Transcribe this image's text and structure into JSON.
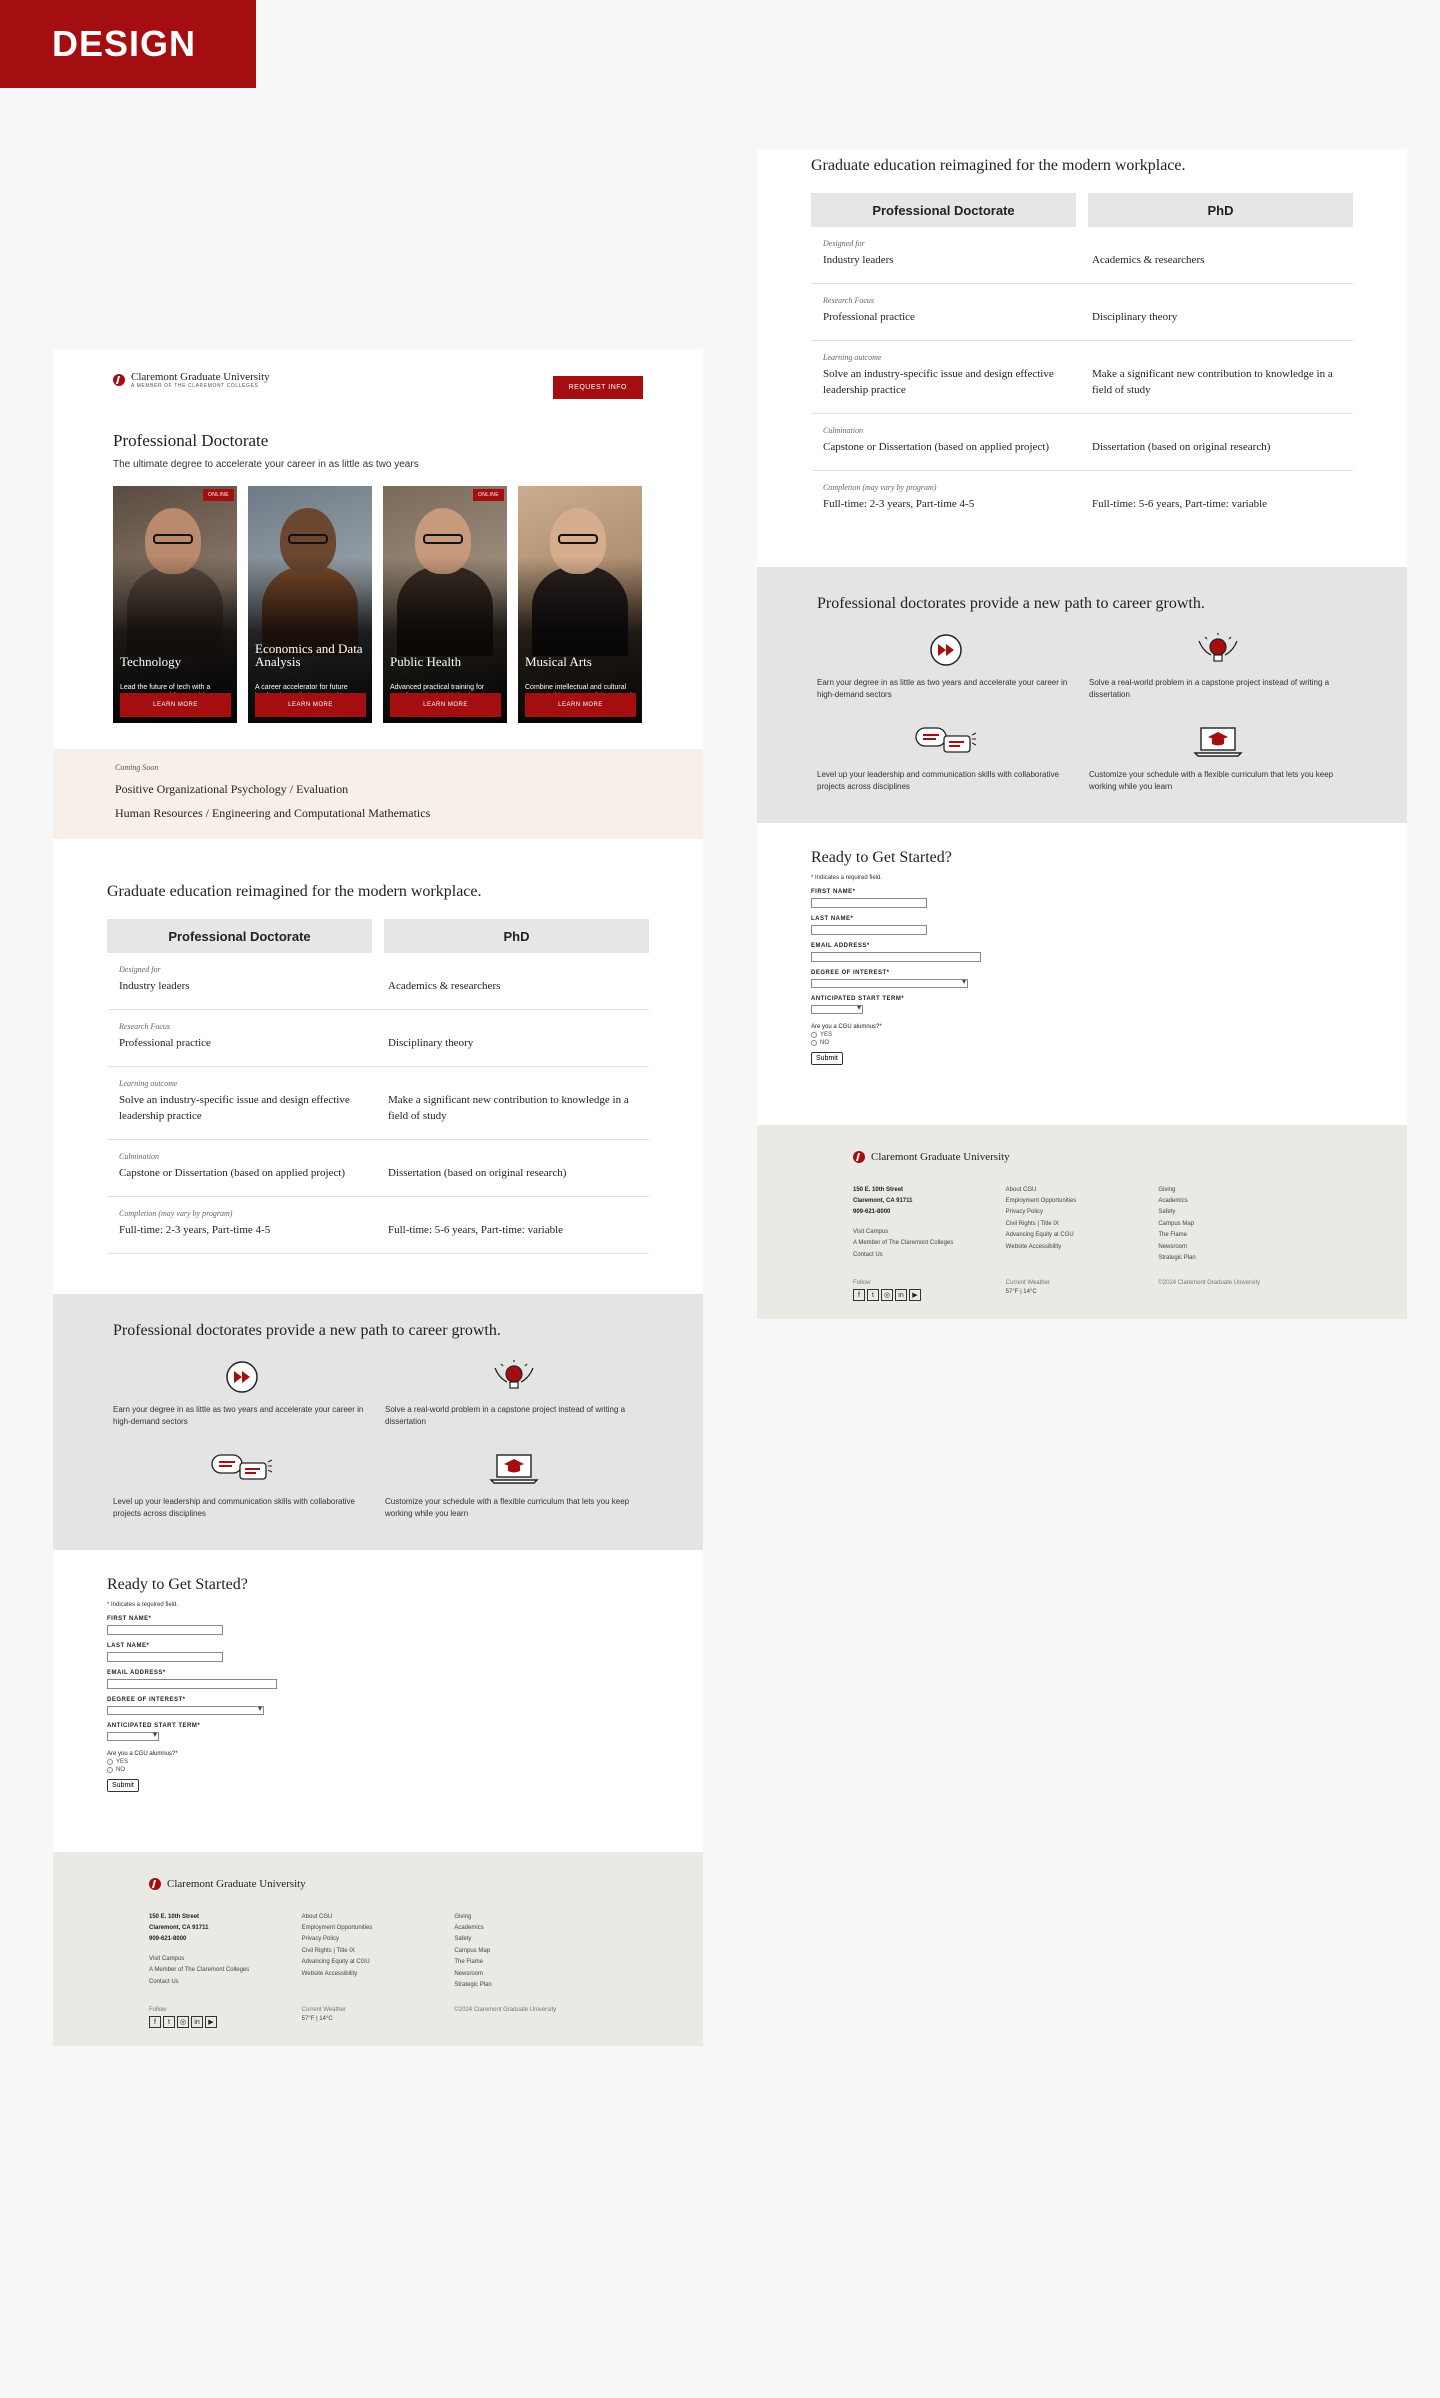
{
  "design_tag": "DESIGN",
  "header": {
    "logo_name": "Claremont Graduate University",
    "logo_sub": "A MEMBER OF THE CLAREMONT COLLEGES",
    "request_button": "REQUEST INFO"
  },
  "hero": {
    "title": "Professional Doctorate",
    "subtitle": "The ultimate degree to accelerate your career in as little as two years"
  },
  "cards": [
    {
      "title": "Technology",
      "desc": "Lead the future of tech with a program created for practitioners, by practitioners",
      "badge": "ONLINE",
      "button": "LEARN MORE"
    },
    {
      "title": "Economics and Data Analysis",
      "desc": "A career accelerator for future leaders in applied economics",
      "badge": "",
      "button": "LEARN MORE"
    },
    {
      "title": "Public Health",
      "desc": "Advanced practical training for transformative health leaders",
      "badge": "ONLINE",
      "button": "LEARN MORE"
    },
    {
      "title": "Musical Arts",
      "desc": "Combine intellectual and cultural context with mastery of theory and performance",
      "badge": "",
      "button": "LEARN MORE"
    }
  ],
  "coming_soon": {
    "label": "Coming Soon",
    "line1": "Positive Organizational Psychology / Evaluation",
    "line2": "Human Resources / Engineering and Computational Mathematics"
  },
  "compare": {
    "title": "Graduate education reimagined for the modern workplace.",
    "col1": "Professional Doctorate",
    "col2": "PhD",
    "rows": [
      {
        "key": "Designed for",
        "a": "Industry leaders",
        "b": "Academics & researchers"
      },
      {
        "key": "Research Focus",
        "a": "Professional practice",
        "b": "Disciplinary theory"
      },
      {
        "key": "Learning outcome",
        "a": "Solve an industry-specific issue and design effective leadership practice",
        "b": "Make a significant new contribution to knowledge in a field of study"
      },
      {
        "key": "Culmination",
        "a": "Capstone or Dissertation (based on applied project)",
        "b": "Dissertation (based on original research)"
      },
      {
        "key": "Completion (may vary by program)",
        "a": "Full-time: 2-3 years, Part-time 4-5",
        "b": "Full-time: 5-6 years, Part-time: variable"
      }
    ]
  },
  "benefits": {
    "title": "Professional doctorates provide a new path to career growth.",
    "items": [
      {
        "icon": "fast-forward-icon",
        "text": "Earn your degree in as little as two years and accelerate your career in high-demand sectors"
      },
      {
        "icon": "lightbulb-icon",
        "text": "Solve a real-world problem in a capstone project instead of writing a dissertation"
      },
      {
        "icon": "chat-bubbles-icon",
        "text": "Level up your leadership and communication skills with collaborative projects across disciplines"
      },
      {
        "icon": "laptop-graduation-icon",
        "text": "Customize your schedule with a flexible curriculum that lets you keep working while you learn"
      }
    ]
  },
  "form": {
    "title": "Ready to Get Started?",
    "required_note": "* Indicates a required field.",
    "first_name": "FIRST NAME*",
    "last_name": "LAST NAME*",
    "email": "EMAIL ADDRESS*",
    "degree": "DEGREE OF INTEREST*",
    "start_term": "ANTICIPATED START TERM*",
    "alumnus": "Are you a CGU alumnus?*",
    "yes": "YES",
    "no": "NO",
    "submit": "Submit"
  },
  "footer": {
    "logo_name": "Claremont Graduate University",
    "address1": "150 E. 10th Street",
    "address2": "Claremont, CA 91711",
    "phone": "909-621-8000",
    "col1_links": [
      "Visit Campus",
      "A Member of The Claremont Colleges",
      "Contact Us"
    ],
    "col2_links": [
      "About CGU",
      "Employment Opportunities",
      "Privacy Policy",
      "Civil Rights | Title IX",
      "Advancing Equity at CGU",
      "Website Accessibility"
    ],
    "col3_links": [
      "Giving",
      "Academics",
      "Safety",
      "Campus Map",
      "The Flame",
      "Newsroom",
      "Strategic Plan"
    ],
    "follow": "Follow",
    "weather_label": "Current Weather",
    "weather_value": "57°F | 14°C",
    "copyright": "©2024 Claremont Graduate University",
    "social": [
      "f",
      "t",
      "◎",
      "in",
      "▶"
    ]
  },
  "colors": {
    "brand_red": "#a50e10",
    "cream": "#f7efe9",
    "grey_band": "#e4e4e4",
    "footer_bg": "#ebe9e4"
  }
}
